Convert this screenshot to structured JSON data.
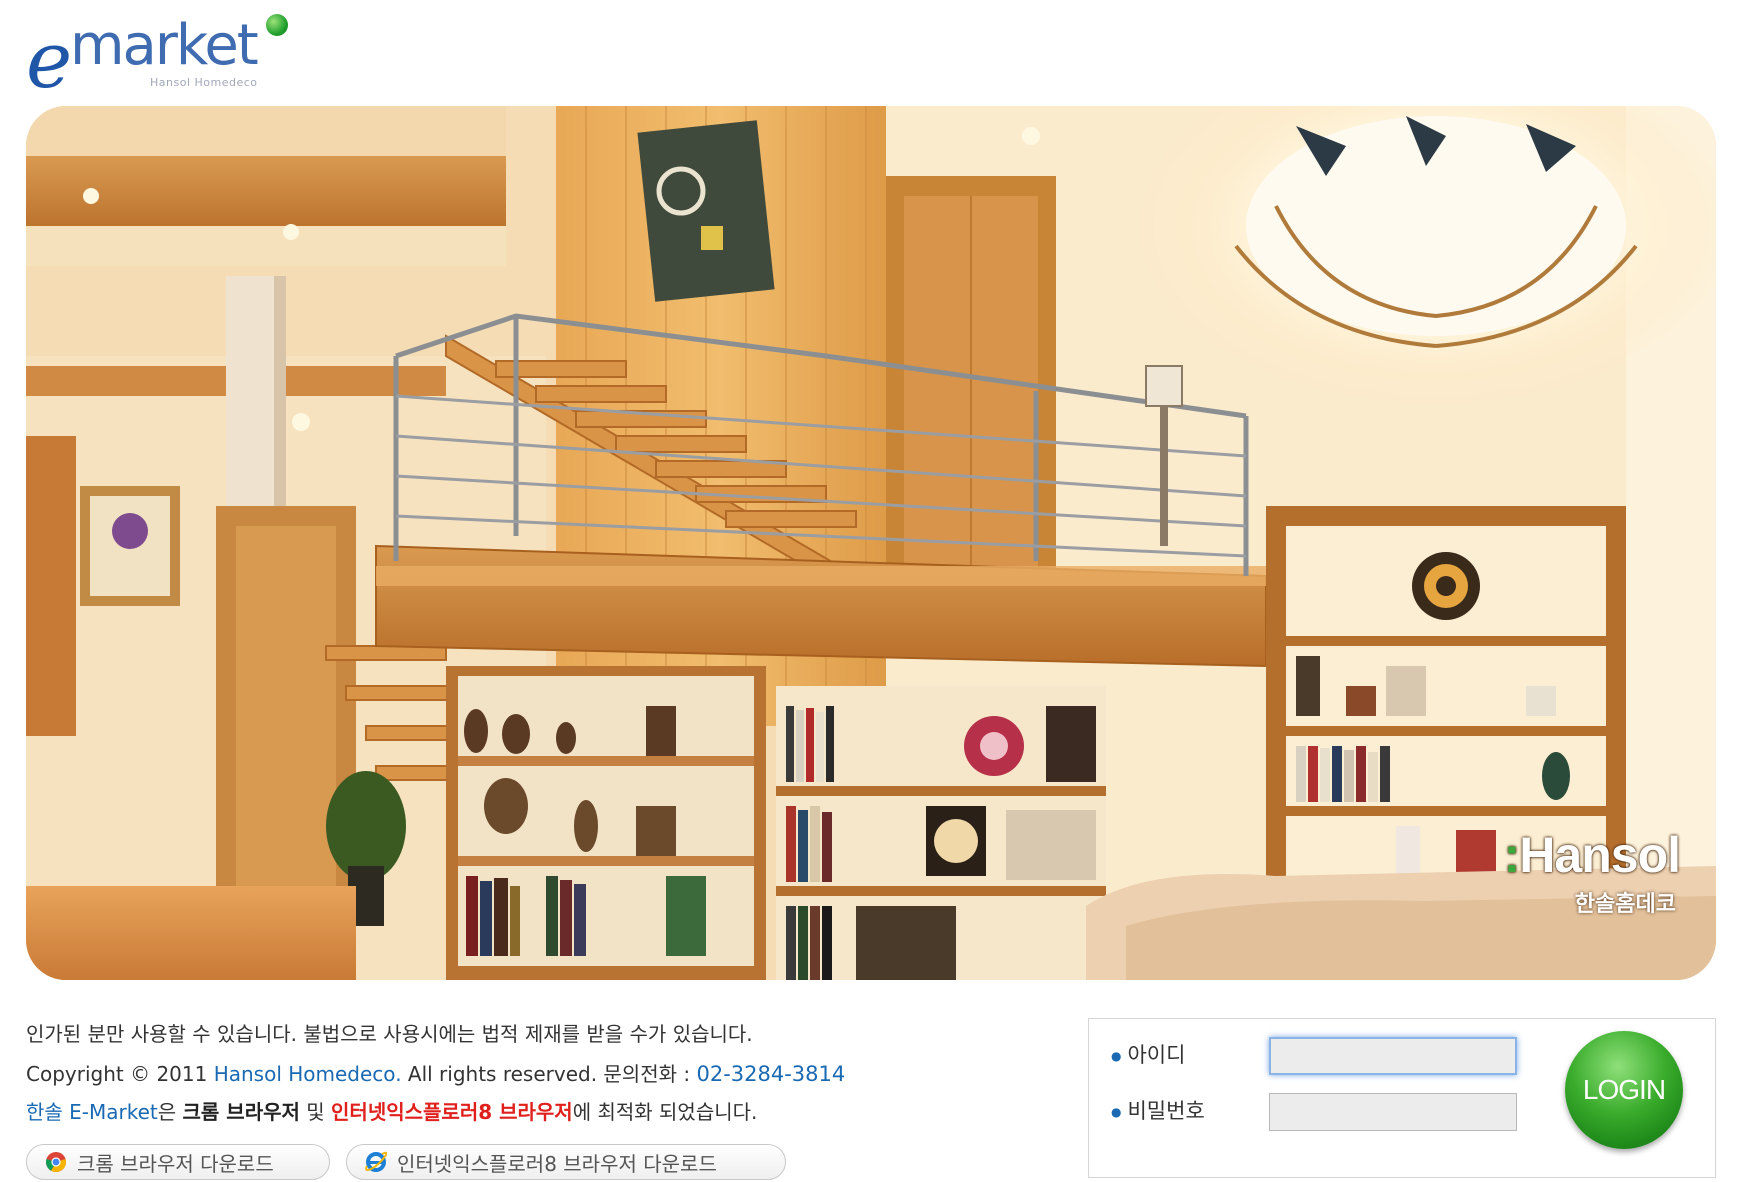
{
  "logo": {
    "main": "market",
    "letter": "e",
    "sub": "Hansol Homedeco"
  },
  "hero": {
    "brand_main": "Hansol",
    "brand_sub": "한솔홈데코"
  },
  "footer": {
    "notice": "인가된 분만 사용할 수 있습니다. 불법으로 사용시에는 법적 제재를 받을 수가 있습니다.",
    "copyright_prefix": "Copyright © 2011 ",
    "company_link": "Hansol Homedeco.",
    "copyright_suffix": " All rights reserved. 문의전화 : ",
    "phone": "02-3284-3814",
    "optimized_link": "한솔 E-Market",
    "optimized_1": "은 ",
    "optimized_chrome": "크롬 브라우저",
    "optimized_2": " 및 ",
    "optimized_ie": "인터넷익스플로러8 브라우저",
    "optimized_3": "에 최적화 되었습니다.",
    "download_chrome": "크롬 브라우저 다운로드",
    "download_ie": "인터넷익스플로러8 브라우저 다운로드"
  },
  "login": {
    "id_label": "아이디",
    "pw_label": "비밀번호",
    "id_value": "",
    "pw_value": "",
    "button_label": "LOGIN"
  },
  "colors": {
    "brand_blue": "#1f56a8",
    "link_blue": "#1a69b3",
    "highlight_red": "#e0201c",
    "login_green": "#3aac2c"
  }
}
